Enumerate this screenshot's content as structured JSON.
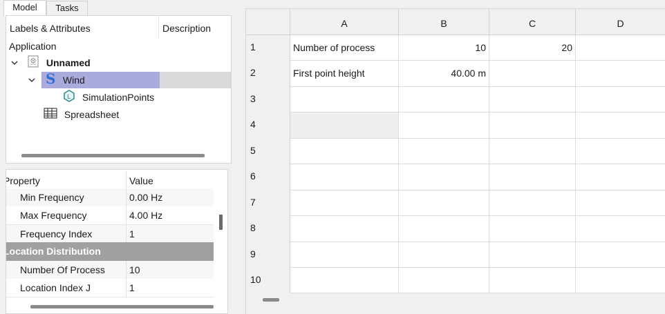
{
  "tabs": [
    {
      "label": "Model",
      "active": true
    },
    {
      "label": "Tasks",
      "active": false
    }
  ],
  "tree": {
    "headers": {
      "col1": "Labels & Attributes",
      "col2": "Description"
    },
    "root_label": "Application",
    "items": [
      {
        "label": "Unnamed",
        "icon": "document-icon",
        "bold": true,
        "expanded": true
      },
      {
        "label": "Wind",
        "icon": "s-letter-icon",
        "selected": true,
        "expanded": true
      },
      {
        "label": "SimulationPoints",
        "icon": "location-hexagon-icon"
      },
      {
        "label": "Spreadsheet",
        "icon": "table-icon"
      }
    ]
  },
  "properties": {
    "headers": {
      "col1": "Property",
      "col2": "Value"
    },
    "rows": [
      {
        "key": "Min Frequency",
        "value": "0.00 Hz"
      },
      {
        "key": "Max Frequency",
        "value": "4.00 Hz"
      },
      {
        "key": "Frequency Index",
        "value": "1"
      }
    ],
    "group": "Location Distribution",
    "group_rows": [
      {
        "key": "Number Of Process",
        "value": "10"
      },
      {
        "key": "Location Index J",
        "value": "1"
      }
    ]
  },
  "sheet": {
    "columns": [
      "A",
      "B",
      "C",
      "D"
    ],
    "rows": [
      "1",
      "2",
      "3",
      "4",
      "5",
      "6",
      "7",
      "8",
      "9",
      "10"
    ],
    "cells": {
      "A1": "Number of process",
      "B1": "10",
      "C1": "20",
      "A2": "First point height",
      "B2": "40.00 m"
    },
    "selected_cell": "A4"
  },
  "colors": {
    "selection": "#aaaadc",
    "group_header": "#a0a0a0",
    "s_icon": "#2a6fd6",
    "hex_icon": "#2a8c8c"
  }
}
